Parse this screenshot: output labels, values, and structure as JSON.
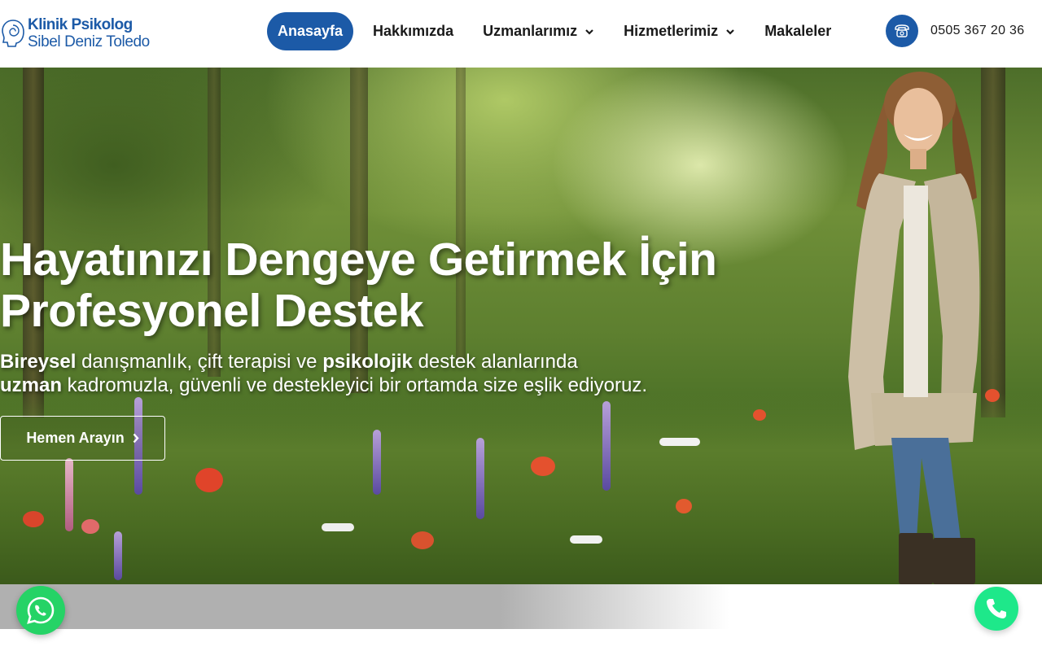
{
  "header": {
    "logo": {
      "line1": "Klinik Psikolog",
      "line2": "Sibel Deniz Toledo",
      "icon": "head-spiral-icon"
    },
    "nav": [
      {
        "label": "Anasayfa",
        "active": true
      },
      {
        "label": "Hakkımızda",
        "active": false
      },
      {
        "label": "Uzmanlarımız",
        "active": false,
        "dropdown": true
      },
      {
        "label": "Hizmetlerimiz",
        "active": false,
        "dropdown": true
      },
      {
        "label": "Makaleler",
        "active": false
      }
    ],
    "phone": {
      "number": "0505 367 20 36",
      "icon": "telephone-icon"
    }
  },
  "hero": {
    "title_line1": "Hayatınızı Dengeye Getirmek İçin",
    "title_line2": "Profesyonel Destek",
    "subtitle": {
      "b1": "Bireysel",
      "t1": " danışmanlık, çift terapisi ve ",
      "b2": "psikolojik",
      "t2": " destek alanlarında",
      "b3": "uzman",
      "t3": " kadromuzla, güvenli ve destekleyici bir ortamda size eşlik ediyoruz."
    },
    "cta_label": "Hemen Arayın"
  },
  "floating": {
    "whatsapp_icon": "whatsapp-icon",
    "call_icon": "phone-call-icon"
  },
  "colors": {
    "brand": "#1c5aa7",
    "whatsapp": "#25d366",
    "call": "#1ee88a"
  }
}
